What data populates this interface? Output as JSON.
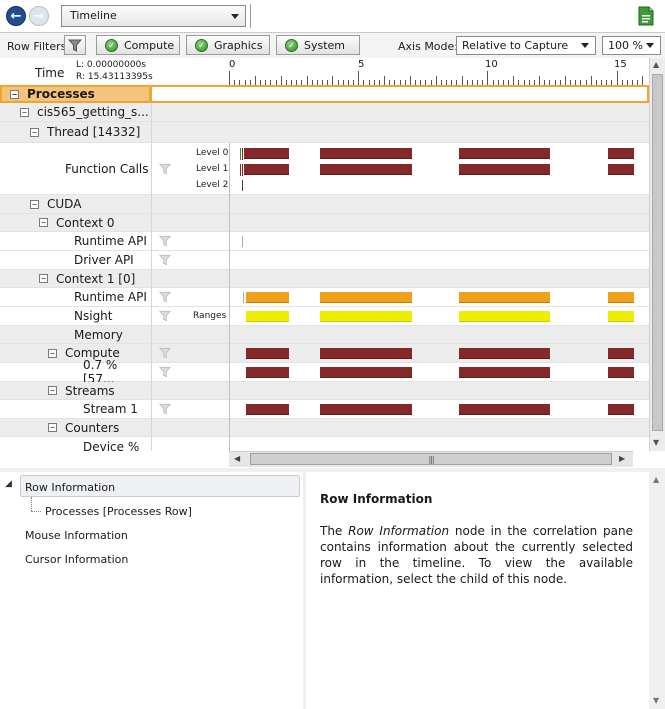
{
  "nav": {
    "view": "Timeline"
  },
  "toolbar": {
    "row_filters": "Row Filters",
    "compute": "Compute",
    "graphics": "Graphics",
    "system": "System",
    "axis_mode_label": "Axis Mode:",
    "axis_mode": "Relative to Capture",
    "zoom": "100 %"
  },
  "ruler": {
    "time_label": "Time",
    "left_time": "L: 0.00000000s",
    "right_time": "R: 15.43113395s",
    "ticks": [
      "0",
      "5",
      "10",
      "15"
    ]
  },
  "rows": {
    "processes": "Processes",
    "process_name": "cis565_getting_s...",
    "thread": "Thread [14332]",
    "function_calls": "Function Calls",
    "level0": "Level 0",
    "level1": "Level 1",
    "level2": "Level 2",
    "cuda": "CUDA",
    "context0": "Context 0",
    "runtime_api_0": "Runtime API",
    "driver_api": "Driver API",
    "context1": "Context 1 [0]",
    "runtime_api_1": "Runtime API",
    "nsight": "Nsight",
    "ranges": "Ranges",
    "memory": "Memory",
    "compute": "Compute",
    "compute_util": "0.7 % [57...",
    "streams": "Streams",
    "stream1": "Stream 1",
    "counters": "Counters",
    "device_pct": "Device %"
  },
  "tree": {
    "row_information": "Row Information",
    "processes_row": "Processes [Processes Row]",
    "mouse_information": "Mouse Information",
    "cursor_information": "Cursor Information"
  },
  "info": {
    "title": "Row Information",
    "text_before": "The ",
    "text_emph": "Row Information",
    "text_after": " node in the correlation pane contains information about the currently selected row in the timeline. To view the available information, select the child of this node."
  },
  "colors": {
    "kernel_bar": "#84282a",
    "runtime_bar": "#f0a11c",
    "range_bar": "#eeee00",
    "selection_border": "#f0a530"
  }
}
